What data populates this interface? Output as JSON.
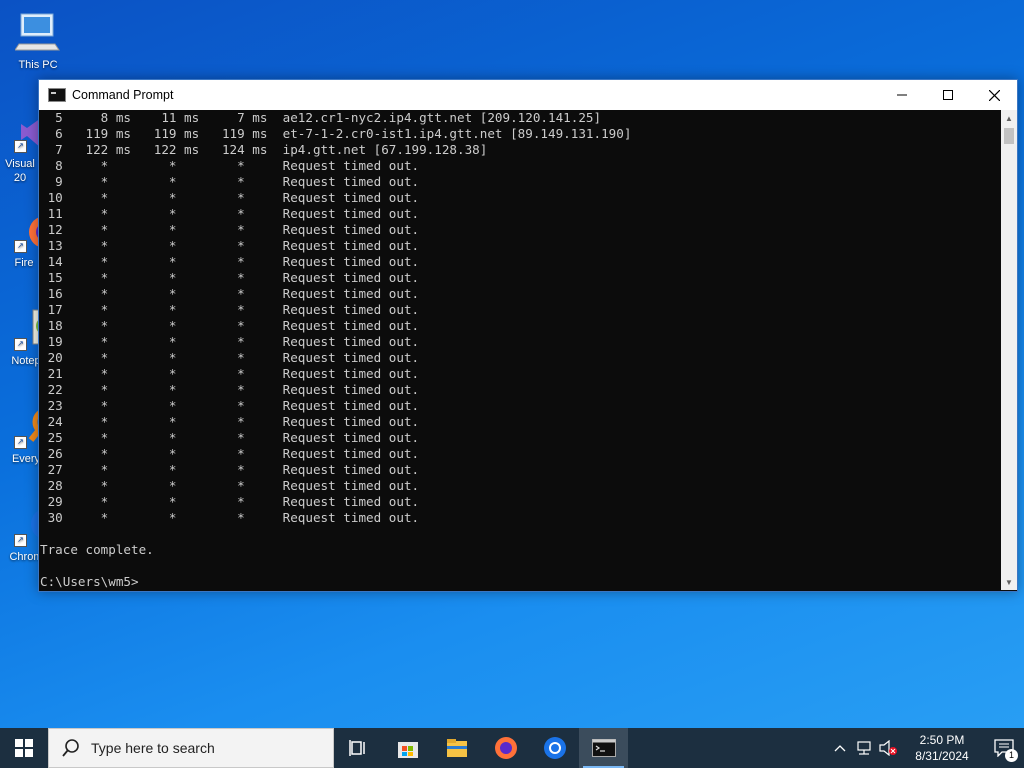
{
  "desktop": {
    "icons": [
      {
        "label": "This PC",
        "icon": "computer-icon"
      },
      {
        "label": "Visual\n20",
        "icon": "visual-studio-icon"
      },
      {
        "label": "Fire",
        "icon": "firefox-icon"
      },
      {
        "label": "Notep",
        "icon": "notepad-icon"
      },
      {
        "label": "Every",
        "icon": "everything-search-icon"
      },
      {
        "label": "Chrom",
        "icon": "chrome-icon"
      }
    ]
  },
  "window": {
    "title": "Command Prompt",
    "minimize_label": "minimize",
    "maximize_label": "maximize",
    "close_label": "close"
  },
  "console": {
    "lines": [
      "  5     8 ms    11 ms     7 ms  ae12.cr1-nyc2.ip4.gtt.net [209.120.141.25]",
      "  6   119 ms   119 ms   119 ms  et-7-1-2.cr0-ist1.ip4.gtt.net [89.149.131.190]",
      "  7   122 ms   122 ms   124 ms  ip4.gtt.net [67.199.128.38]",
      "  8     *        *        *     Request timed out.",
      "  9     *        *        *     Request timed out.",
      " 10     *        *        *     Request timed out.",
      " 11     *        *        *     Request timed out.",
      " 12     *        *        *     Request timed out.",
      " 13     *        *        *     Request timed out.",
      " 14     *        *        *     Request timed out.",
      " 15     *        *        *     Request timed out.",
      " 16     *        *        *     Request timed out.",
      " 17     *        *        *     Request timed out.",
      " 18     *        *        *     Request timed out.",
      " 19     *        *        *     Request timed out.",
      " 20     *        *        *     Request timed out.",
      " 21     *        *        *     Request timed out.",
      " 22     *        *        *     Request timed out.",
      " 23     *        *        *     Request timed out.",
      " 24     *        *        *     Request timed out.",
      " 25     *        *        *     Request timed out.",
      " 26     *        *        *     Request timed out.",
      " 27     *        *        *     Request timed out.",
      " 28     *        *        *     Request timed out.",
      " 29     *        *        *     Request timed out.",
      " 30     *        *        *     Request timed out.",
      "",
      "Trace complete.",
      "",
      "C:\\Users\\wm5>"
    ]
  },
  "taskbar": {
    "search_placeholder": "Type here to search",
    "apps": [
      {
        "name": "task-view-icon"
      },
      {
        "name": "microsoft-store-icon"
      },
      {
        "name": "file-explorer-icon"
      },
      {
        "name": "firefox-icon"
      },
      {
        "name": "chrome-icon"
      },
      {
        "name": "command-prompt-icon",
        "active": true
      }
    ],
    "clock": {
      "time": "2:50 PM",
      "date": "8/31/2024"
    },
    "notification_count": "1"
  }
}
